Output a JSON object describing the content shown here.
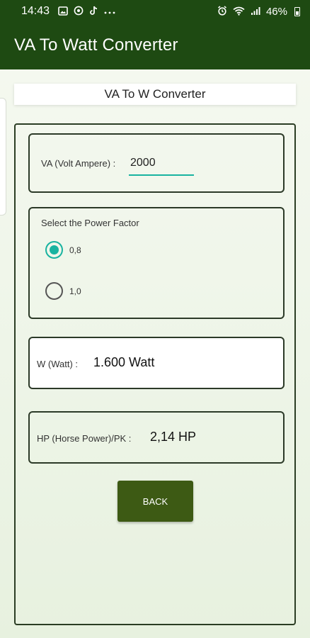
{
  "status_bar": {
    "time": "14:43",
    "battery": "46%",
    "left_icons": [
      "image-icon",
      "whatsapp-icon",
      "tiktok-icon",
      "more-icon"
    ],
    "right_icons": [
      "alarm-icon",
      "wifi-icon",
      "signal-icon",
      "battery-icon"
    ]
  },
  "app_bar": {
    "title": "VA To Watt Converter",
    "background_color": "#1e4a12"
  },
  "page": {
    "title": "VA To W Converter"
  },
  "va_input": {
    "label": "VA (Volt Ampere) :",
    "value": "2000"
  },
  "power_factor": {
    "label": "Select the Power Factor",
    "options": [
      {
        "label": "0,8",
        "selected": true
      },
      {
        "label": "1,0",
        "selected": false
      }
    ],
    "accent_color": "#19b3a0"
  },
  "watt_output": {
    "label": "W (Watt) :",
    "value": "1.600 Watt"
  },
  "hp_output": {
    "label": "HP (Horse Power)/PK :",
    "value": "2,14 HP"
  },
  "back_button": {
    "label": "BACK",
    "color": "#3d5a14"
  }
}
